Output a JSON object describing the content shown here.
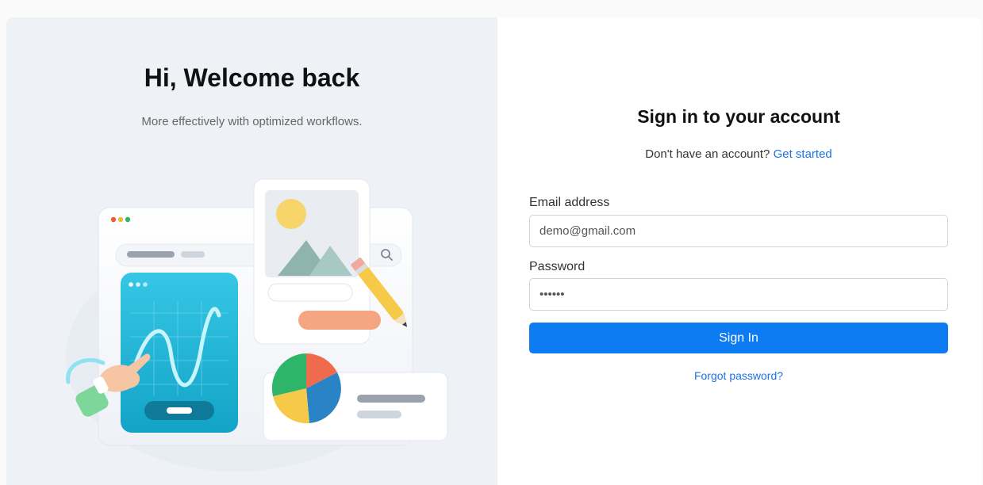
{
  "hero": {
    "title": "Hi, Welcome back",
    "subtitle": "More effectively with optimized workflows."
  },
  "form": {
    "title": "Sign in to your account",
    "signup_prompt": "Don't have an account?",
    "signup_link": "Get started",
    "email_label": "Email address",
    "email_value": "demo@gmail.com",
    "password_label": "Password",
    "password_value": "123456",
    "submit_label": "Sign In",
    "forgot_label": "Forgot password?"
  },
  "colors": {
    "accent": "#0d7bf2",
    "link": "#1a73e8",
    "left_panel_bg": "#eef1f5"
  },
  "illustration": {
    "icons": [
      "search-icon",
      "pencil-icon",
      "pie-chart-icon",
      "image-icon",
      "pointing-hand-icon",
      "line-chart-icon"
    ]
  }
}
